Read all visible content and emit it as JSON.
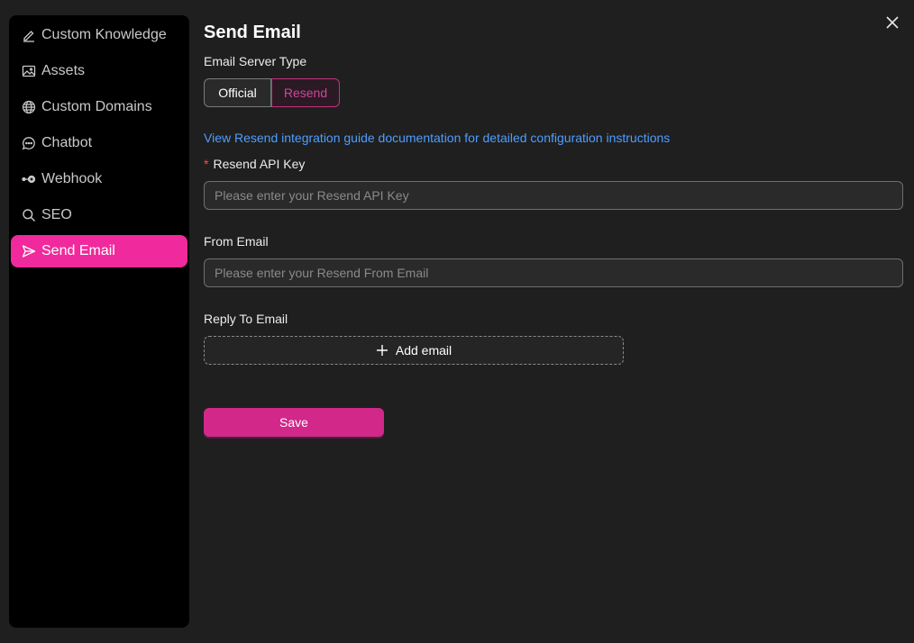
{
  "sidebar": {
    "items": [
      {
        "label": "Custom Knowledge",
        "icon": "edit-icon"
      },
      {
        "label": "Assets",
        "icon": "image-icon"
      },
      {
        "label": "Custom Domains",
        "icon": "globe-icon"
      },
      {
        "label": "Chatbot",
        "icon": "chat-icon"
      },
      {
        "label": "Webhook",
        "icon": "webhook-icon"
      },
      {
        "label": "SEO",
        "icon": "search-icon"
      },
      {
        "label": "Send Email",
        "icon": "send-icon",
        "active": true
      }
    ]
  },
  "main": {
    "title": "Send Email",
    "server_type_label": "Email Server Type",
    "server_type_options": [
      "Official",
      "Resend"
    ],
    "server_type_selected": "Resend",
    "guide_link": "View Resend integration guide documentation for detailed configuration instructions",
    "api_key": {
      "label": "Resend API Key",
      "required_mark": "*",
      "placeholder": "Please enter your Resend API Key",
      "value": ""
    },
    "from_email": {
      "label": "From Email",
      "placeholder": "Please enter your Resend From Email",
      "value": ""
    },
    "reply_to": {
      "label": "Reply To Email",
      "add_label": "Add email"
    },
    "save_label": "Save"
  },
  "colors": {
    "accent": "#f02a9c",
    "link": "#4f9dff",
    "background": "#1f1f1f",
    "sidebar": "#000000"
  }
}
